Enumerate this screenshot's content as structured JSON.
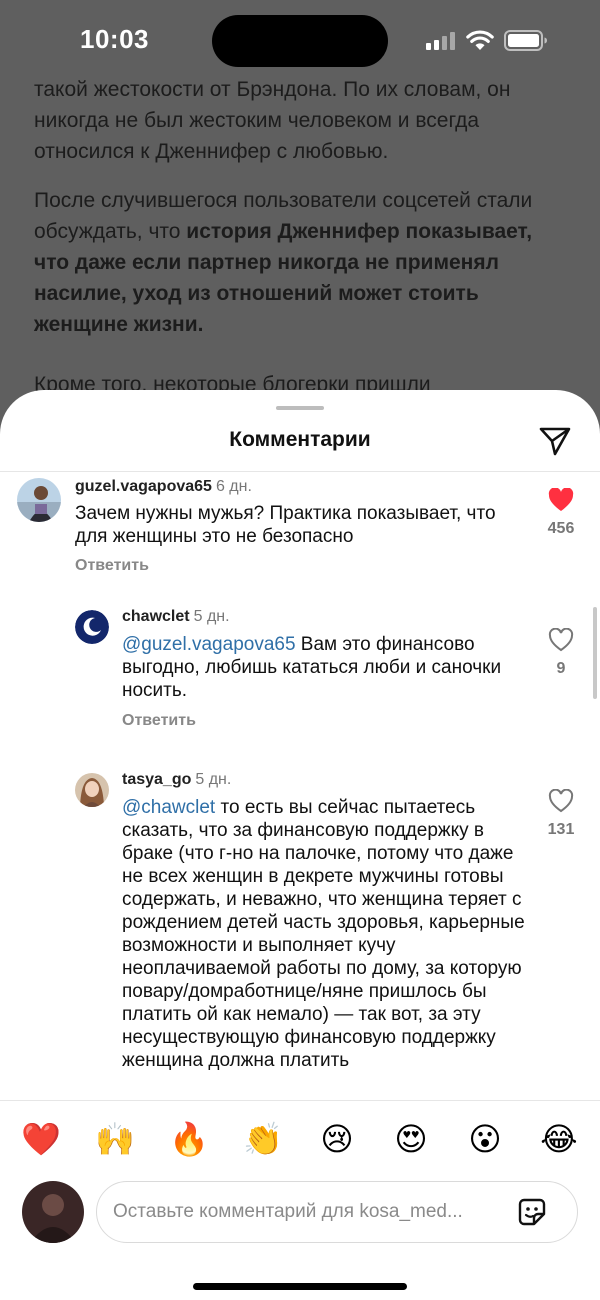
{
  "status_bar": {
    "time": "10:03"
  },
  "article": {
    "p1": "такой жестокости от Брэндона. По их словам, он никогда не был жестоким человеком и всегда относился к Дженнифер с любовью.",
    "p2_normal": "После случившегося пользователи соцсетей стали обсуждать, что ",
    "p2_bold": "история Дженнифер показывает, что даже если партнер никогда не применял насилие, уход из отношений может стоить женщине жизни.",
    "p3": "Кроме того, некоторые блогерки пришли"
  },
  "sheet": {
    "title": "Комментарии"
  },
  "comments": [
    {
      "username": "guzel.vagapova65",
      "time": "6 дн.",
      "mention": "",
      "text": "Зачем нужны мужья? Практика показывает, что для женщины это не безопасно",
      "reply_label": "Ответить",
      "likes": "456",
      "liked": true
    },
    {
      "username": "chawclet",
      "time": "5 дн.",
      "mention": "@guzel.vagapova65",
      "text": " Вам это финансово выгодно, любишь кататься люби и саночки носить.",
      "reply_label": "Ответить",
      "likes": "9",
      "liked": false
    },
    {
      "username": "tasya_go",
      "time": "5 дн.",
      "mention": "@chawclet",
      "text": " то есть вы сейчас пытаетесь сказать, что за финансовую поддержку в браке (что г-но на палочке, потому что даже не всех женщин в декрете мужчины готовы содержать, и неважно, что женщина теряет с рождением детей часть здоровья, карьерные возможности и выполняет кучу неоплачиваемой работы по дому, за которую повару/домработнице/няне пришлось бы платить ой как немало) — так вот, за эту несуществующую финансовую поддержку женщина должна платить",
      "likes": "131",
      "liked": false
    }
  ],
  "reactions": [
    "❤️",
    "🙌",
    "🔥",
    "👏",
    "😢",
    "😍",
    "😮",
    "😂"
  ],
  "input": {
    "placeholder": "Оставьте комментарий для kosa_med..."
  },
  "colors": {
    "like_red": "#ff3040",
    "mention_blue": "#2f6fa7",
    "overlay": "#5f5f5f"
  }
}
